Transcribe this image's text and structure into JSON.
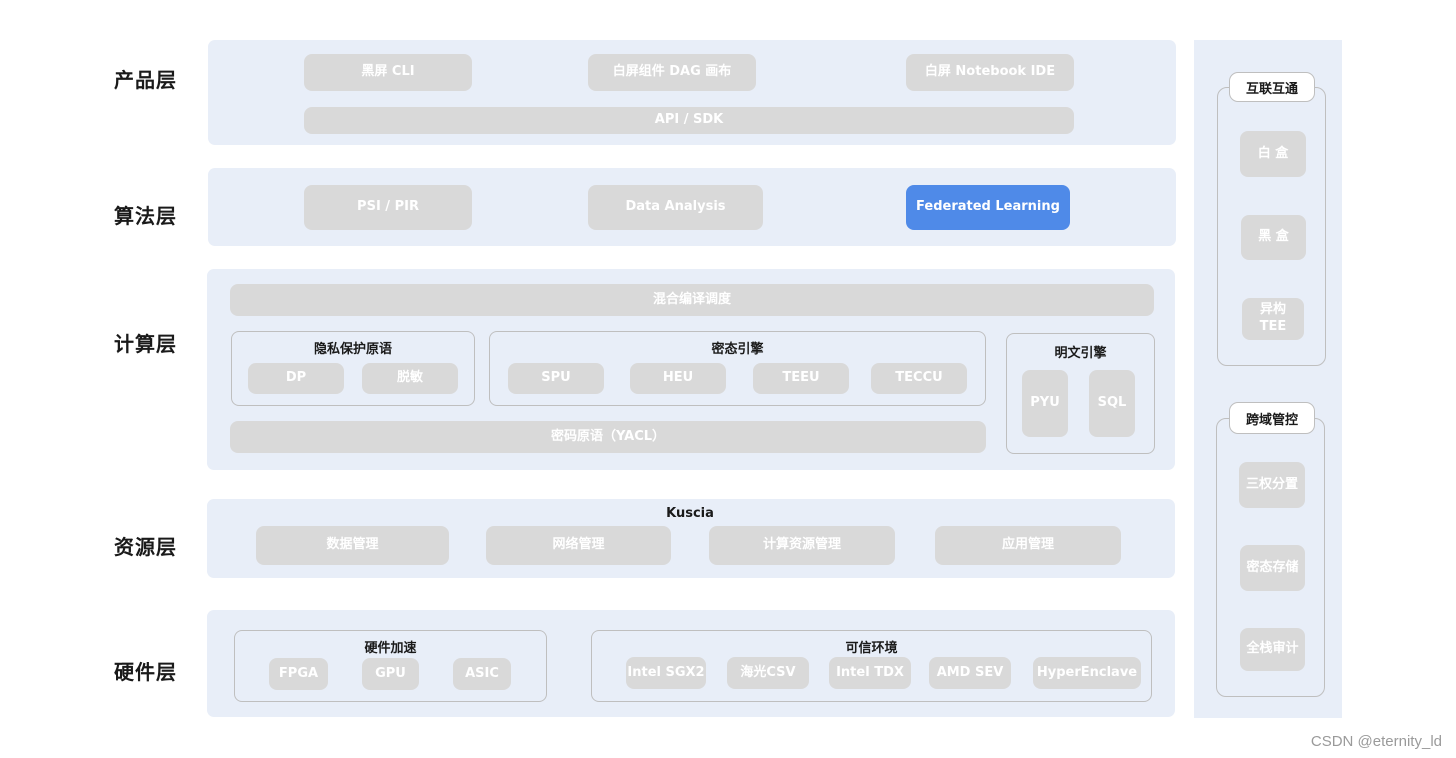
{
  "layers": {
    "product": "产品层",
    "algorithm": "算法层",
    "compute": "计算层",
    "resource": "资源层",
    "hardware": "硬件层"
  },
  "product": {
    "cli": "黑屏 CLI",
    "dag": "白屏组件 DAG 画布",
    "notebook": "白屏 Notebook IDE",
    "api": "API / SDK"
  },
  "algorithm": {
    "psi": "PSI / PIR",
    "analysis": "Data Analysis",
    "fl": "Federated Learning"
  },
  "compute": {
    "hybrid": "混合编译调度",
    "privacy": {
      "title": "隐私保护原语",
      "dp": "DP",
      "desens": "脱敏"
    },
    "cipher": {
      "title": "密态引擎",
      "spu": "SPU",
      "heu": "HEU",
      "teeu": "TEEU",
      "teccu": "TECCU"
    },
    "plain": {
      "title": "明文引擎",
      "pyu": "PYU",
      "sql": "SQL"
    },
    "yacl": "密码原语（YACL）"
  },
  "resource": {
    "title": "Kuscia",
    "data": "数据管理",
    "network": "网络管理",
    "compute": "计算资源管理",
    "app": "应用管理"
  },
  "hardware": {
    "accel": {
      "title": "硬件加速",
      "fpga": "FPGA",
      "gpu": "GPU",
      "asic": "ASIC"
    },
    "trusted": {
      "title": "可信环境",
      "sgx": "Intel SGX2",
      "csv": "海光CSV",
      "tdx": "Intel TDX",
      "sev": "AMD SEV",
      "hyper": "HyperEnclave"
    }
  },
  "side": {
    "interop": {
      "title": "互联互通",
      "white": "白 盒",
      "black": "黑 盒",
      "hetero": "异构",
      "tee": "TEE"
    },
    "cross": {
      "title": "跨域管控",
      "sep": "三权分置",
      "storage": "密态存储",
      "audit": "全栈审计"
    }
  },
  "watermark": "CSDN @eternity_ld",
  "colors": {
    "band": "#e8eef8",
    "chip": "#d9d9d9",
    "active": "#4f8ae8"
  }
}
